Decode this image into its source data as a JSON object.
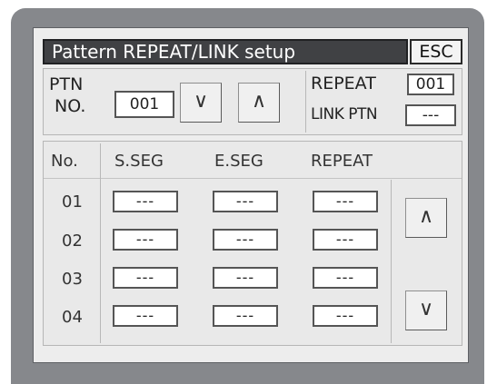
{
  "title": "Pattern REPEAT/LINK setup",
  "esc_label": "ESC",
  "ptn": {
    "label_line1": "PTN",
    "label_line2": "NO.",
    "value": "001",
    "down_symbol": "∨",
    "up_symbol": "∧"
  },
  "repeat": {
    "label": "REPEAT",
    "value": "001"
  },
  "link_ptn": {
    "label": "LINK PTN",
    "value": "---"
  },
  "table": {
    "headers": {
      "no": "No.",
      "s_seg": "S.SEG",
      "e_seg": "E.SEG",
      "repeat": "REPEAT"
    },
    "rows": [
      {
        "no": "01",
        "s_seg": "---",
        "e_seg": "---",
        "repeat": "---"
      },
      {
        "no": "02",
        "s_seg": "---",
        "e_seg": "---",
        "repeat": "---"
      },
      {
        "no": "03",
        "s_seg": "---",
        "e_seg": "---",
        "repeat": "---"
      },
      {
        "no": "04",
        "s_seg": "---",
        "e_seg": "---",
        "repeat": "---"
      }
    ],
    "scroll_up_symbol": "∧",
    "scroll_down_symbol": "∨"
  },
  "colors": {
    "bezel": "#86888c",
    "screen": "#ededed",
    "titlebar": "#404144"
  }
}
